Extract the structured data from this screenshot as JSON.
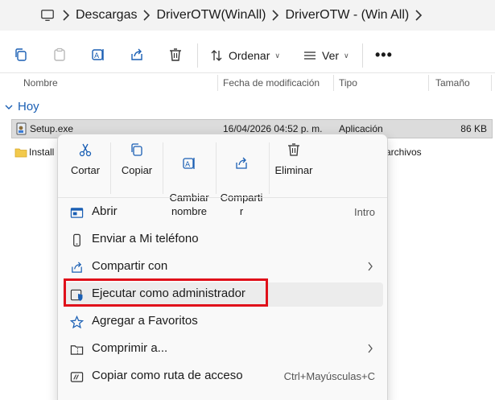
{
  "breadcrumb": [
    "Descargas",
    "DriverOTW(WinAll)",
    "DriverOTW - (Win All)"
  ],
  "toolbar": {
    "sort_label": "Ordenar",
    "view_label": "Ver",
    "more_label": "•••"
  },
  "columns": {
    "name": "Nombre",
    "modified": "Fecha de modificación",
    "type": "Tipo",
    "size": "Tamaño"
  },
  "group_label": "Hoy",
  "files": [
    {
      "name": "Setup.exe",
      "modified": "16/04/2026 04:52 p. m.",
      "type": "Aplicación",
      "size": "86 KB"
    },
    {
      "name": "Install",
      "type_partial": "archivos"
    }
  ],
  "context_menu": {
    "quick_actions": [
      {
        "label": "Cortar",
        "icon": "scissors-icon"
      },
      {
        "label": "Copiar",
        "icon": "copy-icon"
      },
      {
        "label": "Cambiar\nnombre",
        "icon": "rename-icon"
      },
      {
        "label": "Comparti\nr",
        "icon": "share-icon"
      },
      {
        "label": "Eliminar",
        "icon": "trash-icon"
      }
    ],
    "items": [
      {
        "label": "Abrir",
        "shortcut": "Intro",
        "icon": "open-icon"
      },
      {
        "label": "Enviar a Mi teléfono",
        "icon": "phone-icon"
      },
      {
        "label": "Compartir con",
        "icon": "share-icon",
        "submenu": true
      },
      {
        "label": "Ejecutar como administrador",
        "icon": "shield-icon"
      },
      {
        "label": "Agregar a Favoritos",
        "icon": "star-icon"
      },
      {
        "label": "Comprimir a...",
        "icon": "zip-icon",
        "submenu": true
      },
      {
        "label": "Copiar como ruta de acceso",
        "shortcut": "Ctrl+Mayúsculas+C",
        "icon": "path-icon"
      }
    ]
  },
  "colors": {
    "accent": "#1a5fb4",
    "highlight": "#e0101a"
  }
}
